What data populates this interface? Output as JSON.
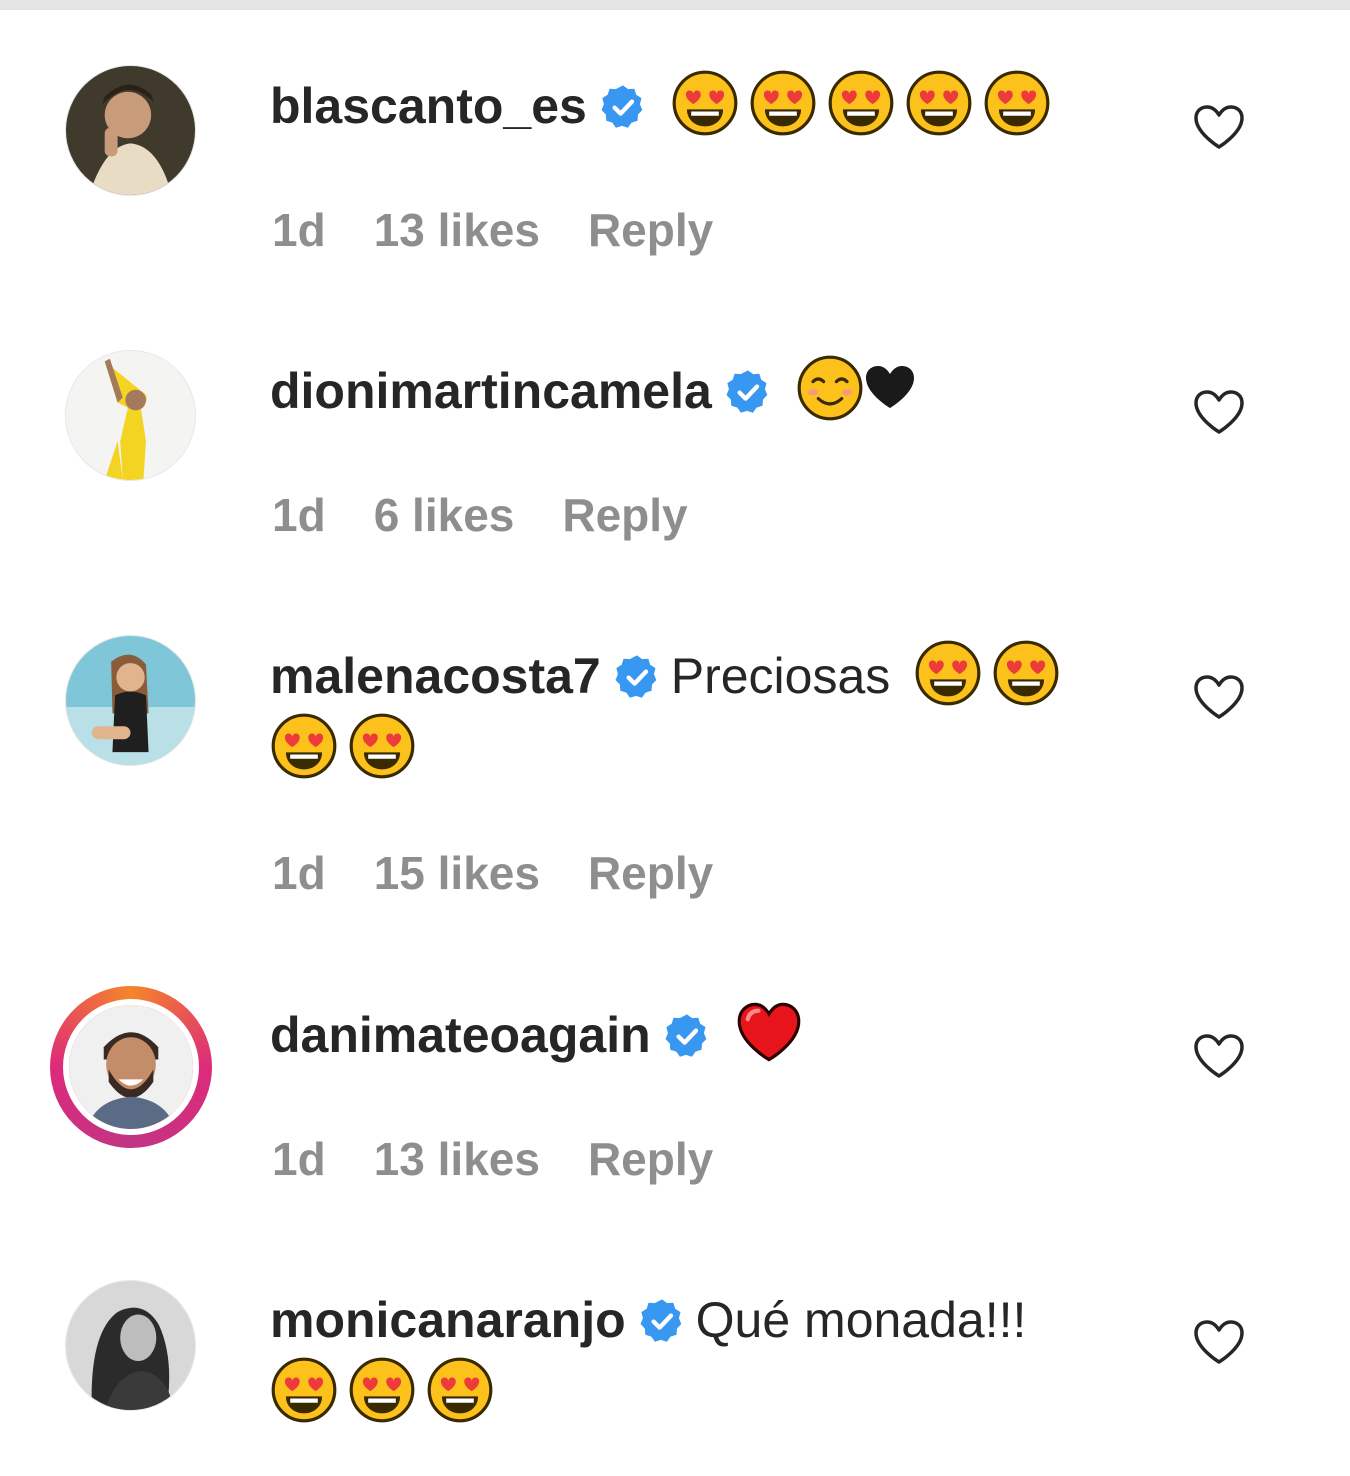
{
  "comments": [
    {
      "username": "blascanto_es",
      "verified": true,
      "text": "",
      "emojis": [
        "heart-eyes",
        "heart-eyes",
        "heart-eyes",
        "heart-eyes",
        "heart-eyes"
      ],
      "time": "1d",
      "likes": "13 likes",
      "reply": "Reply",
      "avatar_ring": false
    },
    {
      "username": "dionimartincamela",
      "verified": true,
      "text": "",
      "emojis": [
        "smiling-face",
        "black-heart"
      ],
      "time": "1d",
      "likes": "6 likes",
      "reply": "Reply",
      "avatar_ring": false
    },
    {
      "username": "malenacosta7",
      "verified": true,
      "text": "Preciosas",
      "emojis": [
        "heart-eyes",
        "heart-eyes",
        "heart-eyes",
        "heart-eyes"
      ],
      "time": "1d",
      "likes": "15 likes",
      "reply": "Reply",
      "avatar_ring": false
    },
    {
      "username": "danimateoagain",
      "verified": true,
      "text": "",
      "emojis": [
        "red-heart"
      ],
      "time": "1d",
      "likes": "13 likes",
      "reply": "Reply",
      "avatar_ring": true
    },
    {
      "username": "monicanaranjo",
      "verified": true,
      "text": "Qué monada!!!",
      "emojis": [
        "heart-eyes",
        "heart-eyes",
        "heart-eyes"
      ],
      "avatar_ring": false
    }
  ],
  "colors": {
    "verified_blue": "#3897f0",
    "meta_gray": "#8e8e8e",
    "text": "#262626",
    "story_ring": [
      "#f58529",
      "#dd2a7b"
    ]
  },
  "icons": {
    "like": "heart-outline-icon",
    "verified": "verified-badge-icon"
  }
}
